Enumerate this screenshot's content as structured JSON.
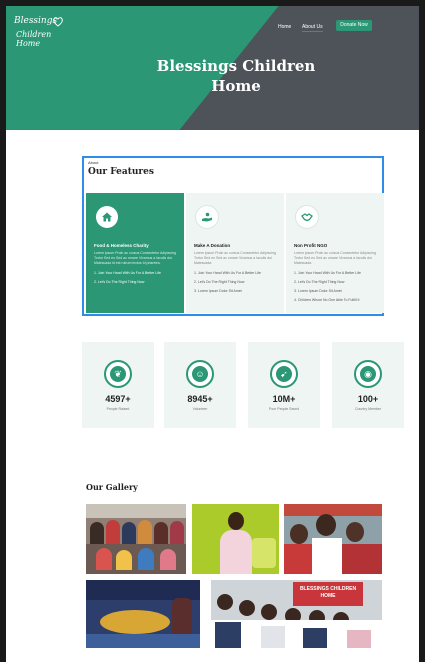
{
  "header": {
    "logo_line1": "Blessings",
    "logo_line2": "Children Home",
    "nav": [
      "Home",
      "About Us"
    ],
    "donate_label": "Donate Now",
    "hero_title_line1": "Blessings Children",
    "hero_title_line2": "Home"
  },
  "features": {
    "eyebrow": "About",
    "title": "Our Features",
    "cards": [
      {
        "title": "Food & Homeless Charity",
        "text": "Lorem ipsum Proin ac cursus Consectetur Adipiscing Tortor Sed eu Sed ac ornare Vivamus a Iaculis dui. Malesuada id est rutrum lectus Id pharetra.",
        "items": [
          "1. Join Your Hand With Us For A Better Life",
          "2. Let's Do The Right Thing Now"
        ],
        "icon": "home-icon"
      },
      {
        "title": "Make A Donation",
        "text": "Lorem ipsum Proin ac cursus Consectetur Adipiscing Tortor Sed eu Sed ac ornare Vivamus a Iaculis dui Malesuada.",
        "items": [
          "1. Join Your Hand With Us For A Better Life",
          "2. Let's Do The Right Thing Now",
          "3. Lorem Ipsum Dolor Sit Amet"
        ],
        "icon": "donation-hand-icon"
      },
      {
        "title": "Non Profit NGO",
        "text": "Lorem ipsum Proin ac cursus Consectetur Adipiscing Tortor Sed eu Sed ac ornare Vivamus a Iaculis dui Malesuada.",
        "items": [
          "1. Join Your Hand With Us For A Better Life",
          "2. Let's Do The Right Thing Now",
          "3. Lorem Ipsum Dolor Sit Amet",
          "4. Children Whom No One Able To Fulfill It"
        ],
        "icon": "handshake-icon"
      }
    ]
  },
  "stats": [
    {
      "value": "4597+",
      "label": "People Raised",
      "icon": "leaf-icon"
    },
    {
      "value": "8945+",
      "label": "Volunteer",
      "icon": "people-icon"
    },
    {
      "value": "10M+",
      "label": "Poor People Saved",
      "icon": "bird-icon"
    },
    {
      "value": "100+",
      "label": "Country Member",
      "icon": "globe-icon"
    }
  ],
  "gallery": {
    "title": "Our Gallery",
    "banner_text": "BLESSINGS CHILDREN HOME"
  },
  "colors": {
    "accent": "#2b9775",
    "hero_dark": "#4d5358",
    "selection": "#2f8ce8"
  }
}
